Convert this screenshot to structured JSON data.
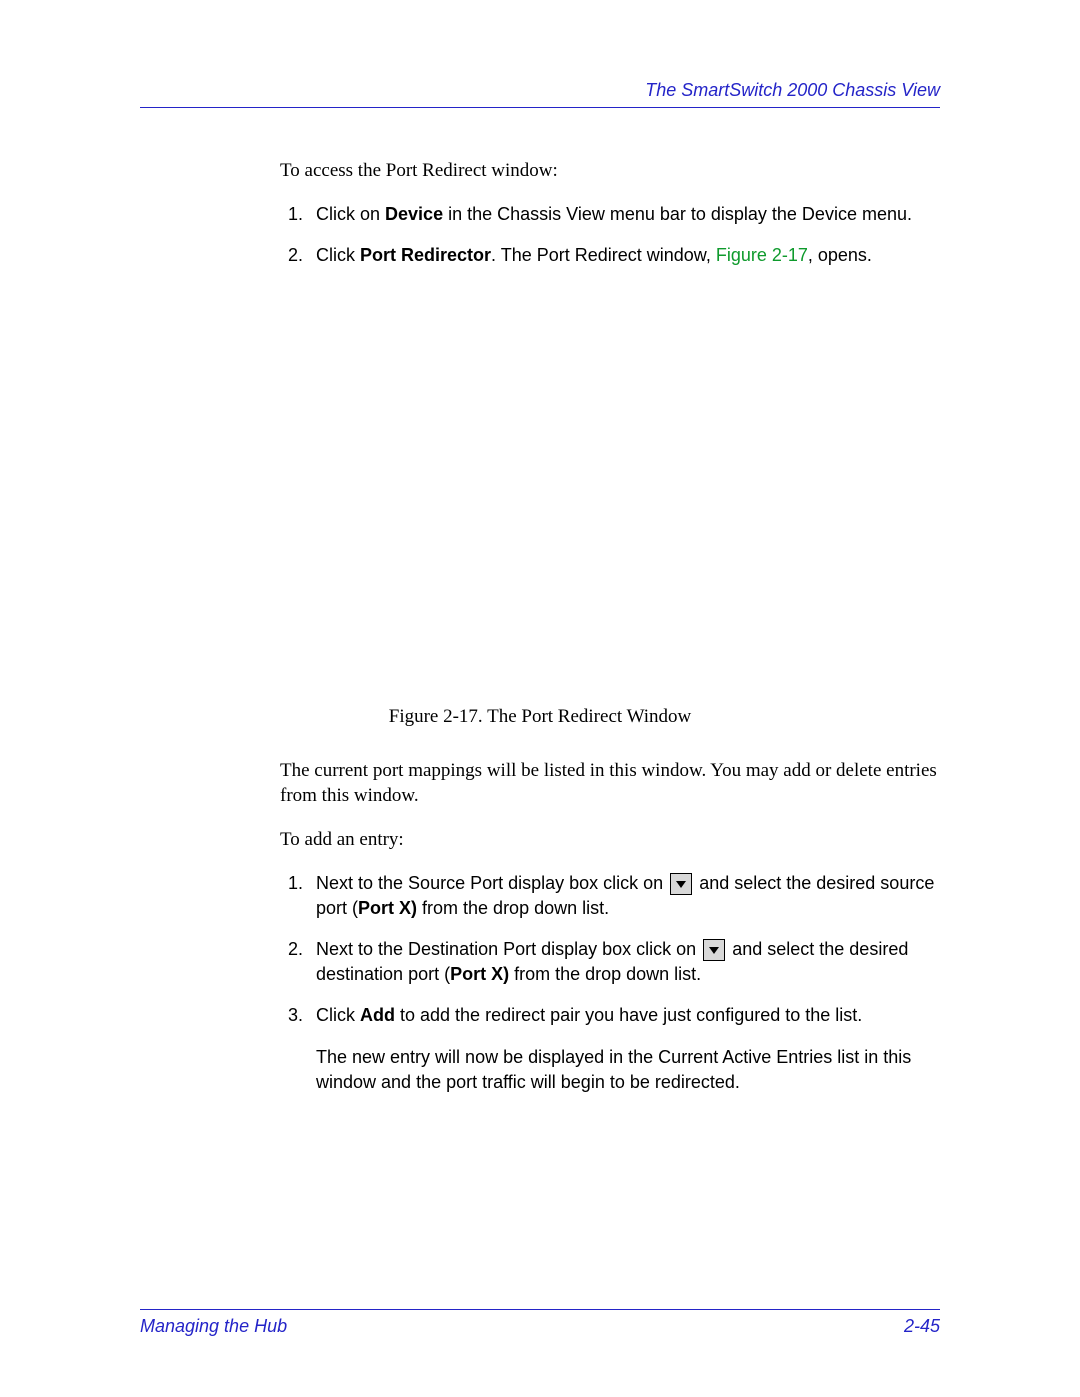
{
  "header": {
    "title": "The SmartSwitch 2000 Chassis View"
  },
  "intro": "To access the Port Redirect window:",
  "steps_a": {
    "s1_a": "Click on ",
    "s1_b": "Device",
    "s1_c": " in the Chassis View menu bar to display the Device menu.",
    "s2_a": "Click ",
    "s2_b": "Port ",
    "s2_c": "Redirector",
    "s2_d": ". The Port Redirect window, ",
    "s2_e": "Figure 2-17",
    "s2_f": ", opens."
  },
  "figure": {
    "caption": "Figure 2-17. The Port Redirect Window"
  },
  "para_after_figure": "The current port mappings will be listed in this window. You may add or delete entries from this window.",
  "add_intro": "To add an entry:",
  "steps_b": {
    "s1_a": "Next to the Source Port display box click on ",
    "s1_b": " and select the desired source port (",
    "s1_c": "Port X)",
    "s1_d": " from the drop down list.",
    "s2_a": "Next to the Destination Port display box click on ",
    "s2_b": " and select the desired destination port (",
    "s2_c": "Port X)",
    "s2_d": " from the drop down list.",
    "s3_a": "Click ",
    "s3_b": "Add",
    "s3_c": " to add the redirect pair you have just configured to the list.",
    "s3_follow": "The new entry will now be displayed in the Current Active Entries list in this window and the port traffic will begin to be redirected."
  },
  "footer": {
    "left": "Managing the Hub",
    "right": "2-45"
  }
}
